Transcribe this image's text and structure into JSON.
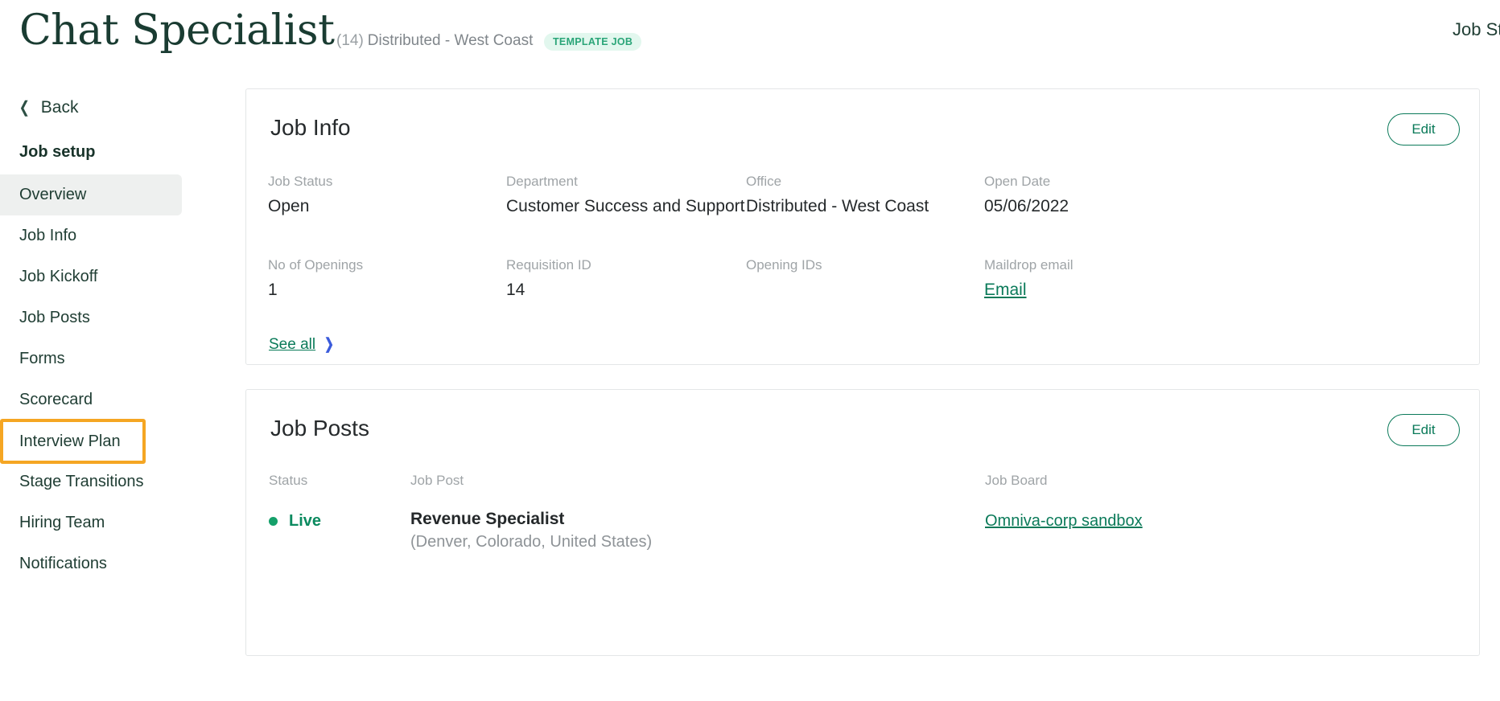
{
  "header": {
    "job_title": "Chat Specialist",
    "requisition_ref": "(14)",
    "office_label": "Distributed - West Coast",
    "badge": "TEMPLATE JOB",
    "badge_bg": "#e2f7ee",
    "badge_color": "#2aa578",
    "top_right_link": "Job St"
  },
  "sidebar": {
    "back_label": "Back",
    "back_icon": "chevron-left-icon",
    "group_title": "Job setup",
    "items": [
      {
        "label": "Overview",
        "state": "active"
      },
      {
        "label": "Job Info",
        "state": "default"
      },
      {
        "label": "Job Kickoff",
        "state": "default"
      },
      {
        "label": "Job Posts",
        "state": "default"
      },
      {
        "label": "Forms",
        "state": "default"
      },
      {
        "label": "Scorecard",
        "state": "default"
      },
      {
        "label": "Interview Plan",
        "state": "highlighted"
      },
      {
        "label": "Stage Transitions",
        "state": "default"
      },
      {
        "label": "Hiring Team",
        "state": "default"
      },
      {
        "label": "Notifications",
        "state": "default"
      }
    ],
    "highlight_color": "#f5a623",
    "active_bg": "#eef0ef"
  },
  "job_info": {
    "title": "Job Info",
    "edit_label": "Edit",
    "fields": [
      {
        "label": "Job Status",
        "value": "Open",
        "kind": "text"
      },
      {
        "label": "Department",
        "value": "Customer Success and Support",
        "kind": "text"
      },
      {
        "label": "Office",
        "value": "Distributed - West Coast",
        "kind": "text"
      },
      {
        "label": "Open Date",
        "value": "05/06/2022",
        "kind": "text"
      },
      {
        "label": "No of Openings",
        "value": "1",
        "kind": "text"
      },
      {
        "label": "Requisition ID",
        "value": "14",
        "kind": "text"
      },
      {
        "label": "Opening IDs",
        "value": "",
        "kind": "empty"
      },
      {
        "label": "Maildrop email",
        "value": "Email",
        "kind": "link"
      }
    ],
    "see_all_label": "See all",
    "see_all_icon": "chevron-right-icon"
  },
  "job_posts": {
    "title": "Job Posts",
    "edit_label": "Edit",
    "columns": [
      "Status",
      "Job Post",
      "Job Board"
    ],
    "rows": [
      {
        "status": "Live",
        "status_dot_color": "#15a06a",
        "post_name": "Revenue Specialist",
        "post_location": "(Denver, Colorado, United States)",
        "job_board": "Omniva-corp sandbox"
      }
    ]
  },
  "theme": {
    "brand_green": "#0a7a59",
    "dark_green": "#1f3d33",
    "muted_gray": "#9fa4a7",
    "card_border": "#e4e6e7",
    "link_blue": "#3b5bdb"
  }
}
